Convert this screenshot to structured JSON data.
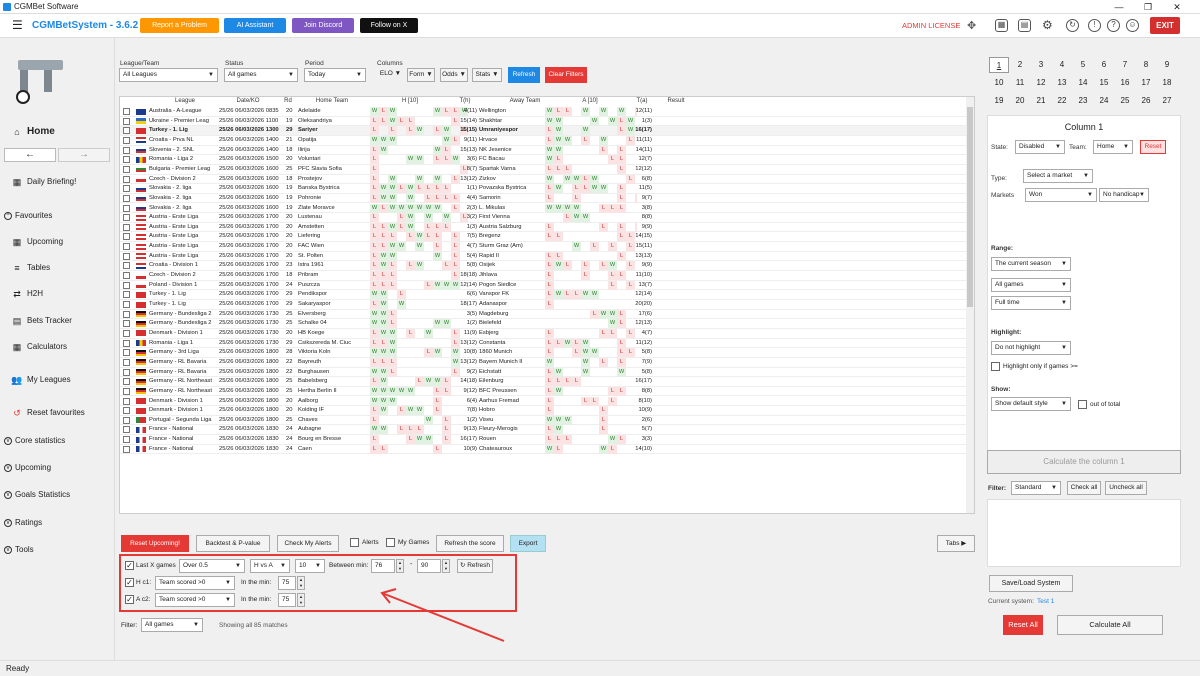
{
  "window": {
    "title": "CGMBet Software"
  },
  "app": {
    "name": "CGMBetSystem - 3.6.2",
    "admin_license": "ADMIN LICENSE",
    "exit": "EXIT"
  },
  "topbar": {
    "report": "Report a Problem",
    "ai": "AI Assistant",
    "discord": "Join Discord",
    "x": "Follow on X"
  },
  "sidebar": {
    "home": "Home",
    "daily": "Daily Briefing!",
    "favourites": "Favourites",
    "upcoming": "Upcoming",
    "tables": "Tables",
    "h2h": "H2H",
    "bets": "Bets Tracker",
    "calculators": "Calculators",
    "myleagues": "My Leagues",
    "reset_fav": "Reset favourites",
    "core": "Core statistics",
    "upcoming2": "Upcoming",
    "goals": "Goals Statistics",
    "ratings": "Ratings",
    "tools": "Tools"
  },
  "filters": {
    "league_label": "League/Team",
    "league_value": "All Leagues",
    "status_label": "Status",
    "status_value": "All games",
    "period_label": "Period",
    "period_value": "Today",
    "columns_label": "Columns",
    "elo": "ELO",
    "form": "Form",
    "odds": "Odds",
    "stats": "Stats",
    "refresh": "Refresh",
    "clear": "Clear Filters"
  },
  "grid": {
    "headers": {
      "league": "League",
      "date": "Date/KO",
      "rd": "Rd",
      "home": "Home Team",
      "h10": "H [10]",
      "th": "T(h)",
      "away": "Away Team",
      "a10": "A [10]",
      "ta": "T(a)",
      "result": "Result"
    },
    "rows": [
      {
        "league": "Australia - A-League",
        "date": "25/26 06/03/2026 0835",
        "rd": "20",
        "home": "Adelaide",
        "hf": "WLW,,,,WLLW",
        "th": "4(11)",
        "away": "Wellington",
        "af": "WLL,W,W,W,L",
        "ta": "12(11)",
        "fl": "au"
      },
      {
        "league": "Ukraine - Premier Leag",
        "date": "25/26 06/03/2026 1100",
        "rd": "19",
        "home": "Oleksandriya",
        "hf": "LLWLL,,,,L",
        "th": "15(14)",
        "away": "Shakhtar",
        "af": "WW,,,W,WLW",
        "ta": "1(3)",
        "fl": "ua"
      },
      {
        "league": "Turkey - 1. Lig",
        "date": "25/26 06/03/2026 1300",
        "rd": "29",
        "home": "Sariyer",
        "hf": "L,L,LW,LW,L",
        "th": "15(15)",
        "away": "Umraniyespor",
        "af": "LW,,W,,,LW",
        "ta": "16(17)",
        "fl": "tr",
        "hl": true
      },
      {
        "league": "Croatia - Prva NL",
        "date": "25/26 06/03/2026 1400",
        "rd": "21",
        "home": "Opatija",
        "hf": "WWW,,,,,WL",
        "th": "9(11)",
        "away": "Hrvace",
        "af": "LWW,L,W,,L",
        "ta": "11(11)",
        "fl": "hr"
      },
      {
        "league": "Slovenia - 2. SNL",
        "date": "25/26 06/03/2026 1400",
        "rd": "18",
        "home": "Ilirija",
        "hf": "LW,,,,,WL",
        "th": "15(13)",
        "away": "NK Jesenice",
        "af": "WW,,,,L,L",
        "ta": "14(11)",
        "fl": "si"
      },
      {
        "league": "Romania - Liga 2",
        "date": "25/26 06/03/2026 1500",
        "rd": "20",
        "home": "Voluntari",
        "hf": "L,,,WW,LLW",
        "th": "3(6)",
        "away": "FC Bacau",
        "af": "WL,,,,,LL",
        "ta": "12(7)",
        "fl": "ro"
      },
      {
        "league": "Bulgaria - Premier Leag",
        "date": "25/26 06/03/2026 1600",
        "rd": "25",
        "home": "PFC Slavia Sofia",
        "hf": "L,,,,,,,,,L",
        "th": "8(7)",
        "away": "Spartak Varna",
        "af": "LLL,,,,,L",
        "ta": "12(12)",
        "fl": "bg"
      },
      {
        "league": "Czech - Division 2",
        "date": "25/26 06/03/2026 1600",
        "rd": "18",
        "home": "Prostejov",
        "hf": "L,W,,W,W,L",
        "th": "13(12)",
        "away": "Zizkov",
        "af": "W,WWLW,,,L",
        "ta": "6(8)",
        "fl": "cz"
      },
      {
        "league": "Slovakia - 2. liga",
        "date": "25/26 06/03/2026 1600",
        "rd": "19",
        "home": "Banska Bystrica",
        "hf": "LWWLWLLLL",
        "th": "1(1)",
        "away": "Povazska Bystrica",
        "af": "LW,LLWW,L",
        "ta": "11(5)",
        "fl": "sk"
      },
      {
        "league": "Slovakia - 2. liga",
        "date": "25/26 06/03/2026 1600",
        "rd": "19",
        "home": "Pohronie",
        "hf": "LWW,W,LLLL",
        "th": "4(4)",
        "away": "Samorin",
        "af": "L,,L,,,,L,L",
        "ta": "9(7)",
        "fl": "sk"
      },
      {
        "league": "Slovakia - 2. liga",
        "date": "25/26 06/03/2026 1600",
        "rd": "19",
        "home": "Zlate Moravce",
        "hf": "WLWWWWWW,L",
        "th": "2(3)",
        "away": "L. Mikulas",
        "af": "WWWW,,LLL",
        "ta": "3(8)",
        "fl": "sk"
      },
      {
        "league": "Austria - Erste Liga",
        "date": "25/26 06/03/2026 1700",
        "rd": "20",
        "home": "Lustenau",
        "hf": "L,,LW,W,W,L",
        "th": "3(2)",
        "away": "First Vienna",
        "af": ",,LWW,,,,",
        "ta": "8(8)",
        "fl": "at"
      },
      {
        "league": "Austria - Erste Liga",
        "date": "25/26 06/03/2026 1700",
        "rd": "20",
        "home": "Amstetten",
        "hf": "LLWLW,LLL",
        "th": "1(3)",
        "away": "Austria Salzburg",
        "af": "L,,,,,L,L,L",
        "ta": "9(9)",
        "fl": "at"
      },
      {
        "league": "Austria - Erste Liga",
        "date": "25/26 06/03/2026 1700",
        "rd": "20",
        "home": "Liefering",
        "hf": "LLL,LWLL,L",
        "th": "7(5)",
        "away": "Bregenz",
        "af": "LL,,,,,,LL",
        "ta": "14(15)",
        "fl": "at"
      },
      {
        "league": "Austria - Erste Liga",
        "date": "25/26 06/03/2026 1700",
        "rd": "20",
        "home": "FAC Wien",
        "hf": "LLWW,W,L,L",
        "th": "4(7)",
        "away": "Sturm Graz (Am)",
        "af": ",,,W,L,L,L",
        "ta": "15(11)",
        "fl": "at"
      },
      {
        "league": "Austria - Erste Liga",
        "date": "25/26 06/03/2026 1700",
        "rd": "20",
        "home": "St. Polten",
        "hf": "LWW,,,,W,L",
        "th": "5(4)",
        "away": "Rapid II",
        "af": "LL,,,,,,L",
        "ta": "13(13)",
        "fl": "at"
      },
      {
        "league": "Croatia - Division 1",
        "date": "25/26 06/03/2026 1700",
        "rd": "23",
        "home": "Istra 1961",
        "hf": "LWL,LW,,LL",
        "th": "5(8)",
        "away": "Osijek",
        "af": "LWL,L,LW,L",
        "ta": "9(9)",
        "fl": "hr"
      },
      {
        "league": "Czech - Division 2",
        "date": "25/26 06/03/2026 1700",
        "rd": "18",
        "home": "Pribram",
        "hf": "LLL,,,,,,L",
        "th": "18(18)",
        "away": "Jihlava",
        "af": "L,,,L,,LL",
        "ta": "11(10)",
        "fl": "cz"
      },
      {
        "league": "Poland - Division 1",
        "date": "25/26 06/03/2026 1700",
        "rd": "24",
        "home": "Puszcza",
        "hf": "LLL,,,LWWW",
        "th": "12(14)",
        "away": "Pogon Siedlce",
        "af": "L,,,,,,L,L",
        "ta": "13(7)",
        "fl": "pl"
      },
      {
        "league": "Turkey - 1. Lig",
        "date": "25/26 06/03/2026 1700",
        "rd": "29",
        "home": "Pendikspor",
        "hf": "WW,L,,,,,",
        "th": "6(6)",
        "away": "Vanspor FK",
        "af": "LWLLWW,,",
        "ta": "12(14)",
        "fl": "tr"
      },
      {
        "league": "Turkey - 1. Lig",
        "date": "25/26 06/03/2026 1700",
        "rd": "29",
        "home": "Sakaryaspor",
        "hf": "LW,W,,,,,",
        "th": "18(17)",
        "away": "Adanaspor",
        "af": "L,,,,,,,,",
        "ta": "20(20)",
        "fl": "tr"
      },
      {
        "league": "Germany - Bundesliga 2",
        "date": "25/26 06/03/2026 1730",
        "rd": "25",
        "home": "Elversberg",
        "hf": "WWL,,,,,,",
        "th": "3(5)",
        "away": "Magdeburg",
        "af": ",,,,,LWWL",
        "ta": "17(6)",
        "fl": "de"
      },
      {
        "league": "Germany - Bundesliga 2",
        "date": "25/26 06/03/2026 1730",
        "rd": "25",
        "home": "Schalke 04",
        "hf": "WWL,,,,WW",
        "th": "1(2)",
        "away": "Bielefeld",
        "af": ",,,,,,,WL",
        "ta": "12(13)",
        "fl": "de"
      },
      {
        "league": "Denmark - Division 1",
        "date": "25/26 06/03/2026 1730",
        "rd": "20",
        "home": "HB Koege",
        "hf": "LWW,L,W,,L",
        "th": "11(9)",
        "away": "Esbjerg",
        "af": "L,,,,,LL,L",
        "ta": "4(7)",
        "fl": "dk"
      },
      {
        "league": "Romania - Liga 1",
        "date": "25/26 06/03/2026 1730",
        "rd": "29",
        "home": "Csikszereda M. Ciuc",
        "hf": "LLW,,,,,,L",
        "th": "13(12)",
        "away": "Constanta",
        "af": "LLWLW,,,L",
        "ta": "11(12)",
        "fl": "ro"
      },
      {
        "league": "Germany - 3rd Liga",
        "date": "25/26 06/03/2026 1800",
        "rd": "28",
        "home": "Viktoria Koln",
        "hf": "WWW,,,LW,W",
        "th": "10(8)",
        "away": "1860 Munich",
        "af": "L,,LWW,,LL",
        "ta": "5(8)",
        "fl": "de"
      },
      {
        "league": "Germany - RL Bavaria",
        "date": "25/26 06/03/2026 1800",
        "rd": "22",
        "home": "Bayreuth",
        "hf": "LLL,,,,,,W",
        "th": "13(12)",
        "away": "Bayern Munich II",
        "af": "W,,,W,L,L",
        "ta": "7(9)",
        "fl": "de"
      },
      {
        "league": "Germany - RL Bavaria",
        "date": "25/26 06/03/2026 1800",
        "rd": "22",
        "home": "Burghausen",
        "hf": "WWL,,,,,,L",
        "th": "9(2)",
        "away": "Eichstatt",
        "af": "LW,,W,,,W",
        "ta": "5(8)",
        "fl": "de"
      },
      {
        "league": "Germany - RL Northeast",
        "date": "25/26 06/03/2026 1800",
        "rd": "25",
        "home": "Babelsberg",
        "hf": "LW,,,LWWL",
        "th": "14(18)",
        "away": "Eilenburg",
        "af": "LLLL,,,,,",
        "ta": "16(17)",
        "fl": "de"
      },
      {
        "league": "Germany - RL Northeast",
        "date": "25/26 06/03/2026 1800",
        "rd": "25",
        "home": "Hertha Berlin II",
        "hf": "WWWWW,,LL",
        "th": "9(12)",
        "away": "BFC Preussen",
        "af": "LW,,,,,LL",
        "ta": "8(8)",
        "fl": "de"
      },
      {
        "league": "Denmark - Division 1",
        "date": "25/26 06/03/2026 1800",
        "rd": "20",
        "home": "Aalborg",
        "hf": "WWW,,,,L",
        "th": "6(4)",
        "away": "Aarhus Fremad",
        "af": "L,,,LL,L",
        "ta": "8(10)",
        "fl": "dk"
      },
      {
        "league": "Denmark - Division 1",
        "date": "25/26 06/03/2026 1800",
        "rd": "20",
        "home": "Kolding IF",
        "hf": "LW,LWW,L",
        "th": "7(8)",
        "away": "Hobro",
        "af": "L,,,,,L",
        "ta": "10(9)",
        "fl": "dk"
      },
      {
        "league": "Portugal - Segunda Liga",
        "date": "25/26 06/03/2026 1800",
        "rd": "25",
        "home": "Chaves",
        "hf": "L,,,,,W,L",
        "th": "1(2)",
        "away": "Viseu",
        "af": "WWW,,,L",
        "ta": "2(6)",
        "fl": "pt"
      },
      {
        "league": "France - National",
        "date": "25/26 06/03/2026 1830",
        "rd": "24",
        "home": "Aubagne",
        "hf": "WW,LLL,,L",
        "th": "9(13)",
        "away": "Fleury-Merogis",
        "af": "LW,,,,L",
        "ta": "5(7)",
        "fl": "fr"
      },
      {
        "league": "France - National",
        "date": "25/26 06/03/2026 1830",
        "rd": "24",
        "home": "Bourg en Bresse",
        "hf": "L,,,LWW,L",
        "th": "16(17)",
        "away": "Rouen",
        "af": "LLL,,,,WL",
        "ta": "3(3)",
        "fl": "fr"
      },
      {
        "league": "France - National",
        "date": "25/26 06/03/2026 1830",
        "rd": "24",
        "home": "Caen",
        "hf": "LL,,,,,L",
        "th": "10(9)",
        "away": "Chateauroux",
        "af": "WL,,,,WL",
        "ta": "14(10)",
        "fl": "fr"
      }
    ]
  },
  "actions": {
    "reset": "Reset Upcoming!",
    "backtest": "Backtest & P-value",
    "alerts_btn": "Check My Alerts",
    "alerts": "Alerts",
    "mygames": "My Games",
    "refresh_score": "Refresh the score",
    "export": "Export",
    "tabs": "Tabs ▶"
  },
  "config": {
    "lastx": "Last X games",
    "over": "Over 0.5",
    "hva": "H vs A",
    "n": "10",
    "between": "Between min:",
    "min_from": "76",
    "min_to": "90",
    "refresh": "↻ Refresh",
    "hc1": "H c1:",
    "ac2": "A c2:",
    "team_scored": "Team scored >0",
    "in_min": "In the min:",
    "v1": "75",
    "v2": "75",
    "dash": "-"
  },
  "footer": {
    "filter_label": "Filter:",
    "filter_value": "All games",
    "showing": "Showing all 85 matches",
    "status": "Ready"
  },
  "right": {
    "nums": [
      "1",
      "2",
      "3",
      "4",
      "5",
      "6",
      "7",
      "8",
      "9",
      "10",
      "11",
      "12",
      "13",
      "14",
      "15",
      "16",
      "17",
      "18",
      "19",
      "20",
      "21",
      "22",
      "23",
      "24",
      "25",
      "26",
      "27"
    ],
    "column_title": "Column 1",
    "state_label": "State:",
    "state": "Disabled",
    "team_label": "Team:",
    "team": "Home",
    "reset": "Reset",
    "type_label": "Type:",
    "type": "Select a market",
    "markets_label": "Markets",
    "market1": "Won",
    "market2": "No handicap",
    "range_label": "Range:",
    "range1": "The current season",
    "range2": "All games",
    "range3": "Full time",
    "highlight_label": "Highlight:",
    "highlight": "Do not highlight",
    "highlight_only": "Highlight only if games >=",
    "show_label": "Show:",
    "show": "Show default style",
    "out_of_total": "out of total",
    "calc_col": "Calculate the column 1",
    "filter_label": "Filter:",
    "filter": "Standard",
    "check_all": "Check all",
    "uncheck_all": "Uncheck all",
    "save_load": "Save/Load System",
    "current_system": "Current system:",
    "system_name": "Test 1",
    "reset_all": "Reset All",
    "calc_all": "Calculate All"
  },
  "colors": {
    "accent": "#1e88e5",
    "red": "#e53935",
    "orange": "#ff9800",
    "purple": "#7e57c2",
    "win": "#2a7d2a",
    "loss": "#c62828"
  }
}
